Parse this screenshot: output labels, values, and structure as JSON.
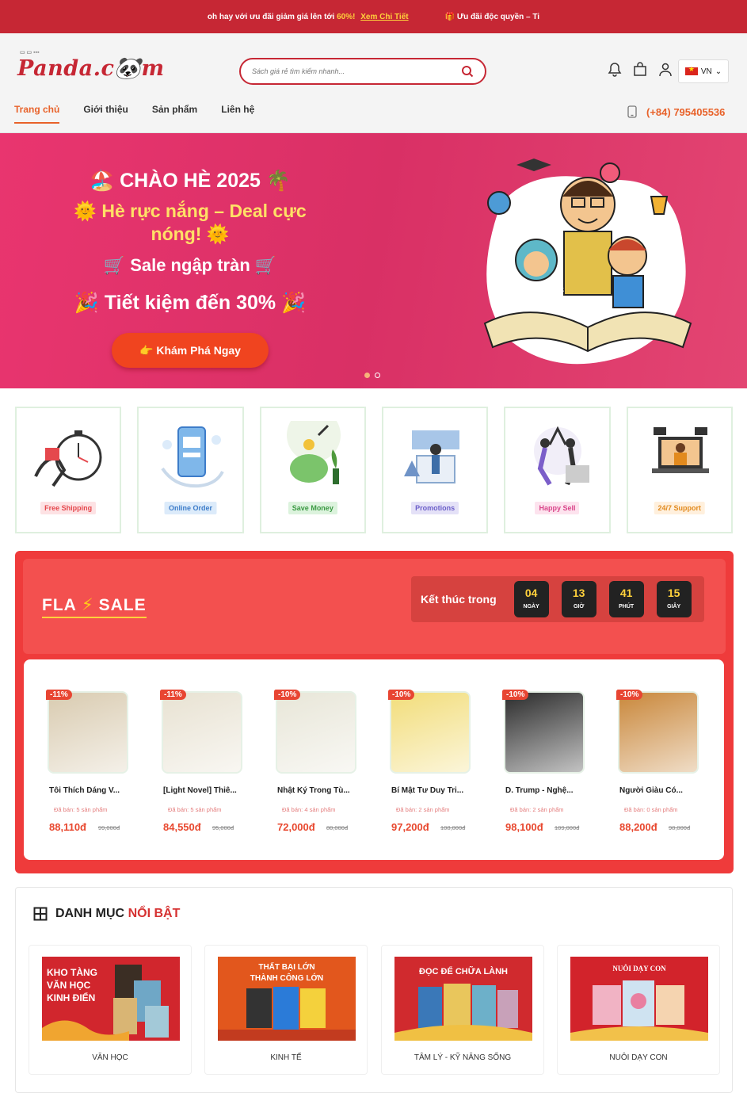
{
  "topbar": {
    "promo_text": "oh hay với ưu đãi giảm giá lên tới",
    "promo_percent": "60%!",
    "promo_link": "Xem Chi Tiết",
    "exclusive": "🎁 Ưu đãi độc quyền – Ti"
  },
  "header": {
    "logo": "Panda.c🐼m",
    "search_placeholder": "Sách giá rẻ tìm kiếm nhanh...",
    "lang": "VN",
    "phone": "(+84) 795405536"
  },
  "nav": [
    {
      "label": "Trang chủ",
      "active": true
    },
    {
      "label": "Giới thiệu",
      "active": false
    },
    {
      "label": "Sản phẩm",
      "active": false
    },
    {
      "label": "Liên hệ",
      "active": false
    }
  ],
  "hero": {
    "line1": "🏖️ CHÀO HÈ 2025 🌴",
    "line2": "🌞 Hè rực nắng – Deal cực nóng! 🌞",
    "line3": "🛒 Sale ngập tràn 🛒",
    "line4": "🎉 Tiết kiệm đến 30% 🎉",
    "cta": "👉 Khám Phá Ngay"
  },
  "features": [
    {
      "label": "Free Shipping",
      "bg": "#fde2e4",
      "fg": "#e5484d"
    },
    {
      "label": "Online Order",
      "bg": "#dcebfa",
      "fg": "#3d7cc9"
    },
    {
      "label": "Save Money",
      "bg": "#dcf3dd",
      "fg": "#3c9a44"
    },
    {
      "label": "Promotions",
      "bg": "#e4e1f7",
      "fg": "#6b5ec9"
    },
    {
      "label": "Happy Sell",
      "bg": "#fde3ee",
      "fg": "#d9458a"
    },
    {
      "label": "24/7 Support",
      "bg": "#fff0dd",
      "fg": "#e28a1e"
    }
  ],
  "flash": {
    "title_a": "FLA",
    "title_b": "SALE",
    "ends_label": "Kết thúc trong",
    "countdown": [
      {
        "value": "04",
        "unit": "NGÀY"
      },
      {
        "value": "13",
        "unit": "GIỜ"
      },
      {
        "value": "41",
        "unit": "PHÚT"
      },
      {
        "value": "15",
        "unit": "GIÂY"
      }
    ],
    "products": [
      {
        "discount": "-11%",
        "name": "Tôi Thích Dáng V...",
        "sold": "Đã bán: 5 sản phẩm",
        "price": "88,110đ",
        "old_price": "99,000đ",
        "cover": "#d9cbb0"
      },
      {
        "discount": "-11%",
        "name": "[Light Novel] Thiê...",
        "sold": "Đã bán: 5 sản phẩm",
        "price": "84,550đ",
        "old_price": "95,000đ",
        "cover": "#e8e2d2"
      },
      {
        "discount": "-10%",
        "name": "Nhật Ký Trong Tù...",
        "sold": "Đã bán: 4 sản phẩm",
        "price": "72,000đ",
        "old_price": "80,000đ",
        "cover": "#e8e6d8"
      },
      {
        "discount": "-10%",
        "name": "Bí Mật Tư Duy Tri...",
        "sold": "Đã bán: 2 sản phẩm",
        "price": "97,200đ",
        "old_price": "108,000đ",
        "cover": "#f2dd7a"
      },
      {
        "discount": "-10%",
        "name": "D. Trump - Nghệ...",
        "sold": "Đã bán: 2 sản phẩm",
        "price": "98,100đ",
        "old_price": "109,000đ",
        "cover": "#2b2b2b"
      },
      {
        "discount": "-10%",
        "name": "Người Giàu Có...",
        "sold": "Đã bán: 0 sản phẩm",
        "price": "88,200đ",
        "old_price": "98,000đ",
        "cover": "#c9873a"
      }
    ]
  },
  "categories": {
    "title_a": "DANH MỤC",
    "title_b": "NỔI BẬT",
    "items": [
      {
        "label": "VĂN HỌC",
        "banner_text": "KHO TÀNG VĂN HỌC KINH ĐIỂN",
        "color": "#d1262d"
      },
      {
        "label": "KINH TẾ",
        "banner_text": "THẤT BẠI LỚN THÀNH CÔNG LỚN",
        "color": "#e2571d"
      },
      {
        "label": "TÂM LÝ - KỸ NĂNG SỐNG",
        "banner_text": "ĐỌC ĐỂ CHỮA LÀNH",
        "color": "#d02a2e"
      },
      {
        "label": "NUÔI DẠY CON",
        "banner_text": "NUÔI DẠY CON",
        "color": "#d2232b"
      }
    ]
  }
}
